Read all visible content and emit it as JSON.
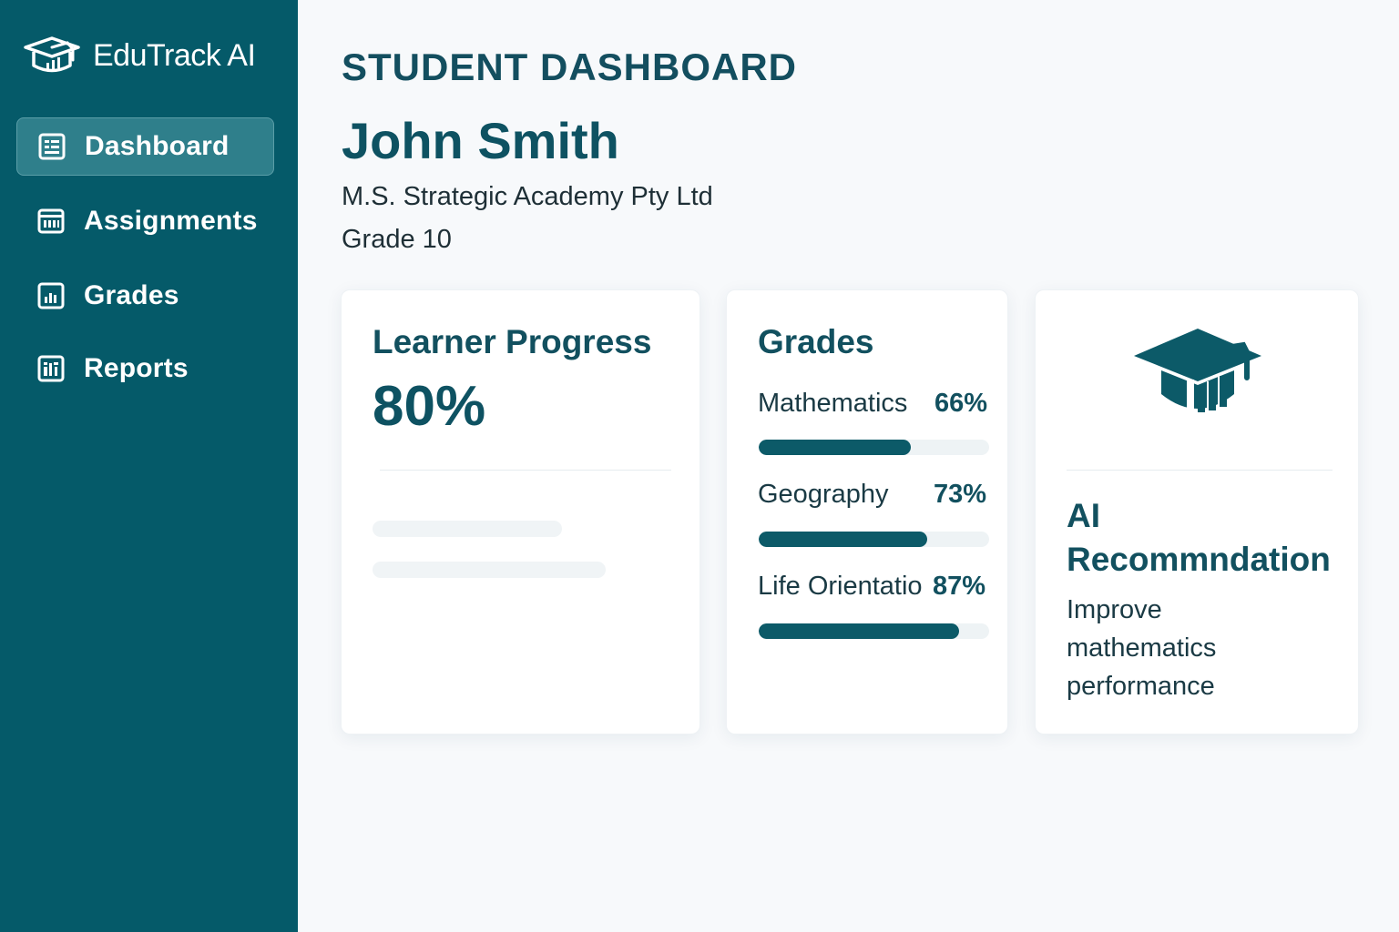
{
  "app": {
    "name": "EduTrack AI"
  },
  "sidebar": {
    "items": [
      {
        "label": "Dashboard",
        "icon": "dashboard-icon",
        "active": true
      },
      {
        "label": "Assignments",
        "icon": "assignments-icon",
        "active": false
      },
      {
        "label": "Grades",
        "icon": "grades-icon",
        "active": false
      },
      {
        "label": "Reports",
        "icon": "reports-icon",
        "active": false
      }
    ]
  },
  "header": {
    "title": "STUDENT DASHBOARD",
    "student_name": "John Smith",
    "school": "M.S. Strategic Academy Pty Ltd",
    "grade_level": "Grade 10"
  },
  "progress_card": {
    "title": "Learner Progress",
    "value": "80%"
  },
  "grades_card": {
    "title": "Grades",
    "subjects": [
      {
        "name": "Mathematics",
        "percent_label": "66%",
        "percent": 66
      },
      {
        "name": "Geography",
        "percent_label": "73%",
        "percent": 73
      },
      {
        "name": "Life Orientatio",
        "percent_label": "87%",
        "percent": 87
      }
    ]
  },
  "ai_card": {
    "icon": "graduation-cap-chart-icon",
    "title": "AI Recommndation",
    "text": "Improve mathematics performance"
  },
  "colors": {
    "sidebar": "#055a69",
    "accent": "#0c5a68",
    "active_item": "#2f7f8b",
    "background": "#f7f9fb"
  }
}
